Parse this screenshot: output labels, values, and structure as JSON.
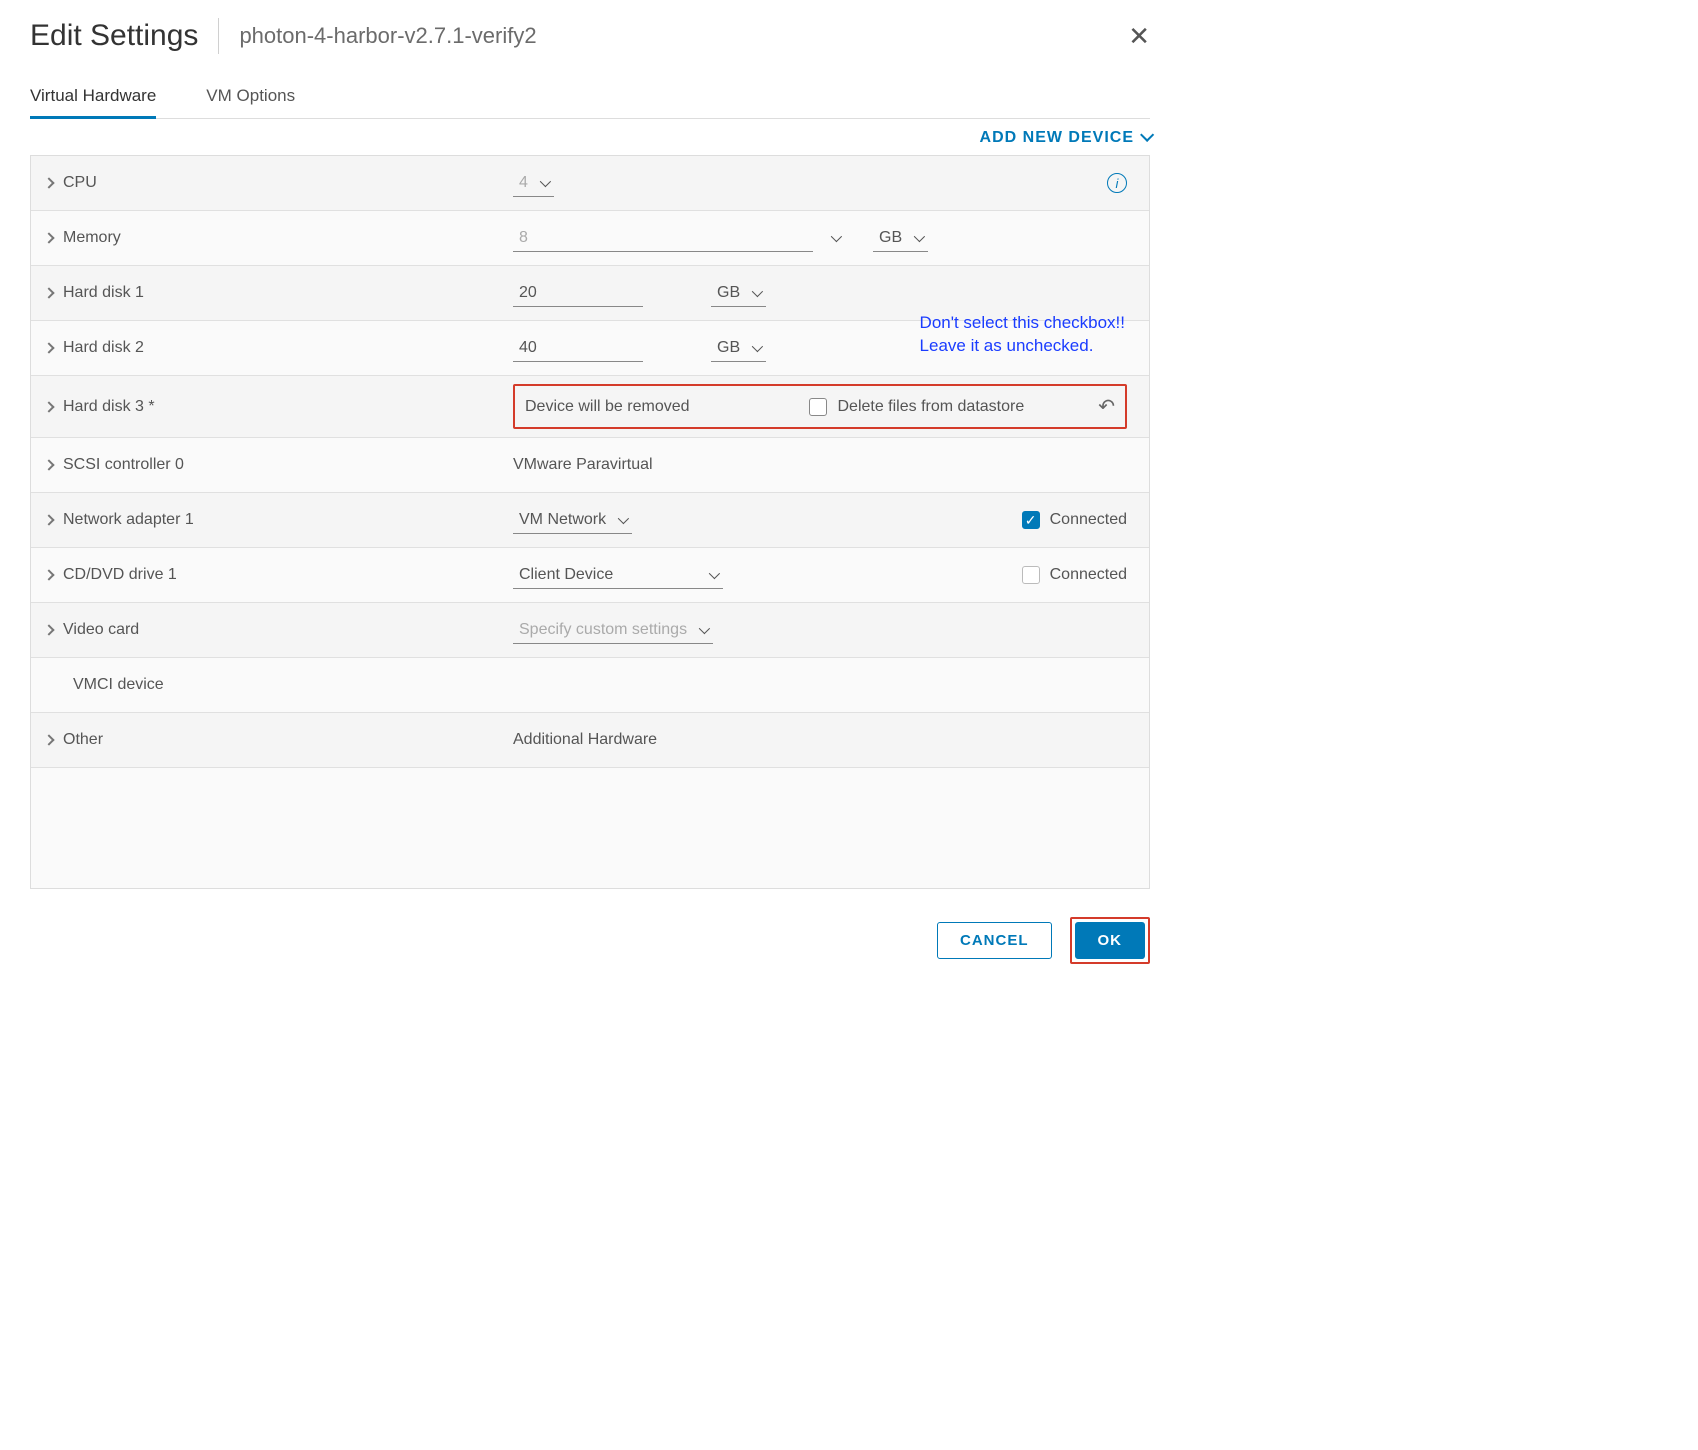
{
  "header": {
    "title": "Edit Settings",
    "subtitle": "photon-4-harbor-v2.7.1-verify2"
  },
  "tabs": {
    "virtual_hardware": "Virtual Hardware",
    "vm_options": "VM Options"
  },
  "actions": {
    "add_device": "ADD NEW DEVICE"
  },
  "rows": {
    "cpu": {
      "label": "CPU",
      "value": "4"
    },
    "memory": {
      "label": "Memory",
      "value": "8",
      "unit": "GB"
    },
    "hd1": {
      "label": "Hard disk 1",
      "value": "20",
      "unit": "GB"
    },
    "hd2": {
      "label": "Hard disk 2",
      "value": "40",
      "unit": "GB"
    },
    "hd3": {
      "label": "Hard disk 3 *",
      "status": "Device will be removed",
      "delete_label": "Delete files from datastore"
    },
    "scsi": {
      "label": "SCSI controller 0",
      "value": "VMware Paravirtual"
    },
    "net": {
      "label": "Network adapter 1",
      "value": "VM Network",
      "connected_label": "Connected"
    },
    "cd": {
      "label": "CD/DVD drive 1",
      "value": "Client Device",
      "connected_label": "Connected"
    },
    "video": {
      "label": "Video card",
      "value": "Specify custom settings"
    },
    "vmci": {
      "label": "VMCI device"
    },
    "other": {
      "label": "Other",
      "value": "Additional Hardware"
    }
  },
  "annotation": {
    "line1": "Don't select this checkbox!!",
    "line2": "Leave it as unchecked."
  },
  "footer": {
    "cancel": "CANCEL",
    "ok": "OK"
  }
}
